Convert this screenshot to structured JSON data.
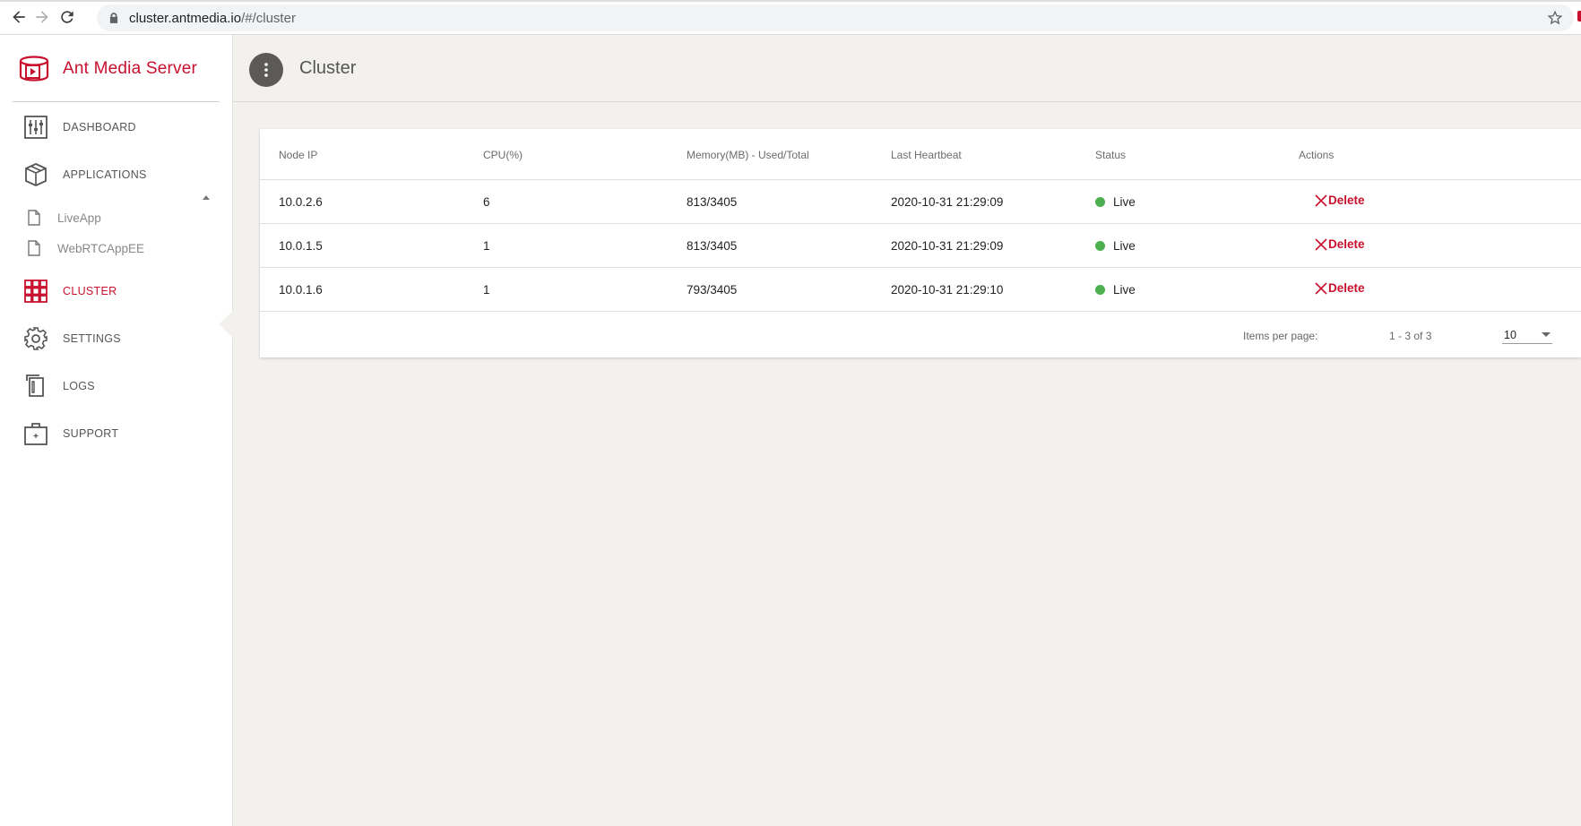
{
  "browser": {
    "url_host": "cluster.antmedia.io",
    "url_path": "/#/cluster"
  },
  "sidebar": {
    "brand": "Ant Media Server",
    "items": [
      {
        "label": "DASHBOARD",
        "icon": "sliders-icon"
      },
      {
        "label": "APPLICATIONS",
        "icon": "box-icon"
      },
      {
        "label": "CLUSTER",
        "icon": "grid-icon"
      },
      {
        "label": "SETTINGS",
        "icon": "gear-icon"
      },
      {
        "label": "LOGS",
        "icon": "logs-icon"
      },
      {
        "label": "SUPPORT",
        "icon": "support-box-icon"
      }
    ],
    "apps": [
      {
        "label": "LiveApp",
        "icon": "file-icon"
      },
      {
        "label": "WebRTCAppEE",
        "icon": "file-icon"
      }
    ],
    "active": "CLUSTER"
  },
  "header": {
    "title": "Cluster"
  },
  "table": {
    "columns": [
      "Node IP",
      "CPU(%)",
      "Memory(MB) - Used/Total",
      "Last Heartbeat",
      "Status",
      "Actions"
    ],
    "rows": [
      {
        "ip": "10.0.2.6",
        "cpu": "6",
        "memory": "813/3405",
        "heartbeat": "2020-10-31 21:29:09",
        "status": "Live",
        "action": "Delete"
      },
      {
        "ip": "10.0.1.5",
        "cpu": "1",
        "memory": "813/3405",
        "heartbeat": "2020-10-31 21:29:09",
        "status": "Live",
        "action": "Delete"
      },
      {
        "ip": "10.0.1.6",
        "cpu": "1",
        "memory": "793/3405",
        "heartbeat": "2020-10-31 21:29:10",
        "status": "Live",
        "action": "Delete"
      }
    ],
    "paginator": {
      "items_per_page_label": "Items per page:",
      "items_per_page": "10",
      "range": "1 - 3 of 3"
    }
  },
  "colors": {
    "brand": "#c8102e",
    "live": "#4caf50",
    "main_bg": "#f2f1ee"
  }
}
